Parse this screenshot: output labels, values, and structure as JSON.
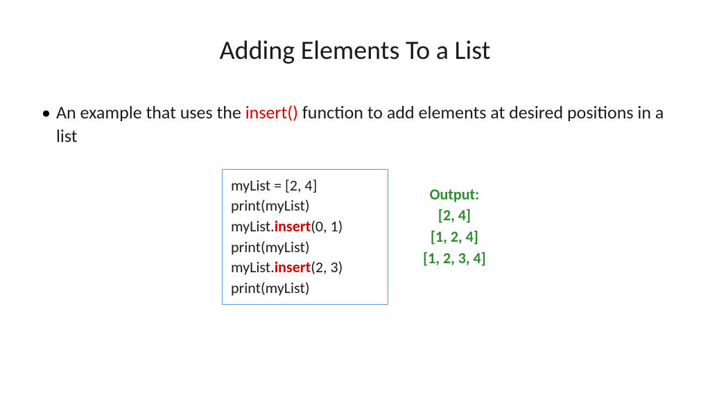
{
  "title": "Adding Elements To a List",
  "bullet": {
    "prefix": "An example that uses the ",
    "highlight": "insert()",
    "suffix": " function to add elements at desired positions in a list"
  },
  "code": {
    "line1": "myList = [2, 4]",
    "line2": "print(myList)",
    "line3_pre": "myList.",
    "line3_kw": "insert",
    "line3_post": "(0, 1)",
    "line4": "print(myList)",
    "line5_pre": "myList.",
    "line5_kw": "insert",
    "line5_post": "(2, 3)",
    "line6": "print(myList)"
  },
  "output": {
    "label": "Output:",
    "line1": "[2, 4]",
    "line2": "[1, 2, 4]",
    "line3": "[1, 2, 3, 4]"
  }
}
